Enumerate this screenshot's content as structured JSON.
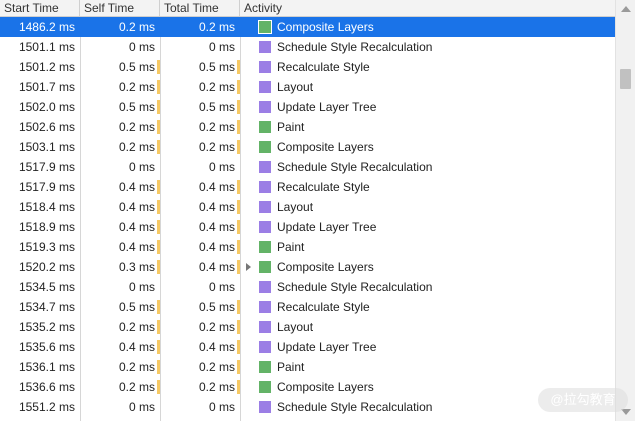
{
  "columns": {
    "start_time": "Start Time",
    "self_time": "Self Time",
    "total_time": "Total Time",
    "activity": "Activity"
  },
  "colors": {
    "selected_row": "#1a73e8",
    "purple_category": "#9b7ee5",
    "green_category": "#63b367",
    "time_bar": "#f6c964"
  },
  "rows": [
    {
      "start": "1486.2 ms",
      "self": "0.2 ms",
      "total": "0.2 ms",
      "activity": "Composite Layers",
      "color": "green",
      "selected": true
    },
    {
      "start": "1501.1 ms",
      "self": "0 ms",
      "total": "0 ms",
      "activity": "Schedule Style Recalculation",
      "color": "purple"
    },
    {
      "start": "1501.2 ms",
      "self": "0.5 ms",
      "total": "0.5 ms",
      "activity": "Recalculate Style",
      "color": "purple"
    },
    {
      "start": "1501.7 ms",
      "self": "0.2 ms",
      "total": "0.2 ms",
      "activity": "Layout",
      "color": "purple"
    },
    {
      "start": "1502.0 ms",
      "self": "0.5 ms",
      "total": "0.5 ms",
      "activity": "Update Layer Tree",
      "color": "purple"
    },
    {
      "start": "1502.6 ms",
      "self": "0.2 ms",
      "total": "0.2 ms",
      "activity": "Paint",
      "color": "green"
    },
    {
      "start": "1503.1 ms",
      "self": "0.2 ms",
      "total": "0.2 ms",
      "activity": "Composite Layers",
      "color": "green"
    },
    {
      "start": "1517.9 ms",
      "self": "0 ms",
      "total": "0 ms",
      "activity": "Schedule Style Recalculation",
      "color": "purple"
    },
    {
      "start": "1517.9 ms",
      "self": "0.4 ms",
      "total": "0.4 ms",
      "activity": "Recalculate Style",
      "color": "purple"
    },
    {
      "start": "1518.4 ms",
      "self": "0.4 ms",
      "total": "0.4 ms",
      "activity": "Layout",
      "color": "purple"
    },
    {
      "start": "1518.9 ms",
      "self": "0.4 ms",
      "total": "0.4 ms",
      "activity": "Update Layer Tree",
      "color": "purple"
    },
    {
      "start": "1519.3 ms",
      "self": "0.4 ms",
      "total": "0.4 ms",
      "activity": "Paint",
      "color": "green"
    },
    {
      "start": "1520.2 ms",
      "self": "0.3 ms",
      "total": "0.4 ms",
      "activity": "Composite Layers",
      "color": "green",
      "expandable": true
    },
    {
      "start": "1534.5 ms",
      "self": "0 ms",
      "total": "0 ms",
      "activity": "Schedule Style Recalculation",
      "color": "purple"
    },
    {
      "start": "1534.7 ms",
      "self": "0.5 ms",
      "total": "0.5 ms",
      "activity": "Recalculate Style",
      "color": "purple"
    },
    {
      "start": "1535.2 ms",
      "self": "0.2 ms",
      "total": "0.2 ms",
      "activity": "Layout",
      "color": "purple"
    },
    {
      "start": "1535.6 ms",
      "self": "0.4 ms",
      "total": "0.4 ms",
      "activity": "Update Layer Tree",
      "color": "purple"
    },
    {
      "start": "1536.1 ms",
      "self": "0.2 ms",
      "total": "0.2 ms",
      "activity": "Paint",
      "color": "green"
    },
    {
      "start": "1536.6 ms",
      "self": "0.2 ms",
      "total": "0.2 ms",
      "activity": "Composite Layers",
      "color": "green"
    },
    {
      "start": "1551.2 ms",
      "self": "0 ms",
      "total": "0 ms",
      "activity": "Schedule Style Recalculation",
      "color": "purple"
    }
  ],
  "watermark": "@拉勾教育"
}
